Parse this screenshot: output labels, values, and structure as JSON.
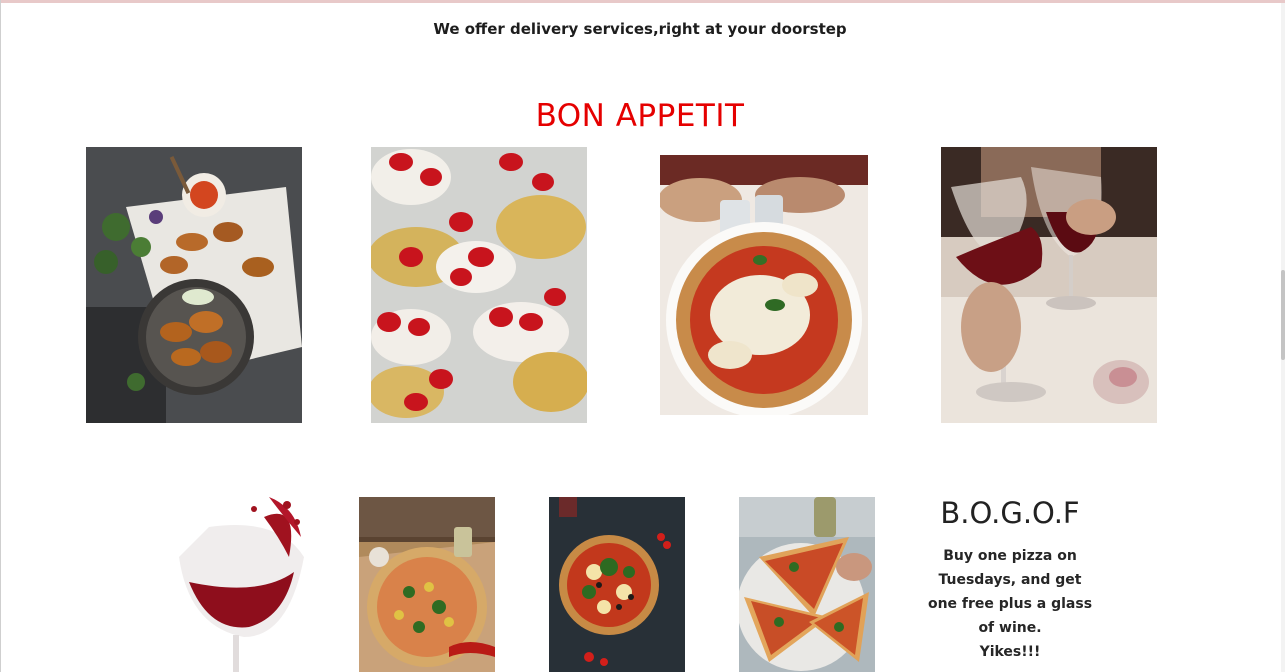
{
  "header": {
    "tagline": "We offer delivery services,right at your doorstep"
  },
  "gallery": {
    "title": "BON APPETIT",
    "title_color": "#e50000",
    "row1": [
      {
        "name": "chicken-wings-photo"
      },
      {
        "name": "strawberry-shortcake-photo"
      },
      {
        "name": "margherita-pizza-photo"
      },
      {
        "name": "red-wine-glasses-photo"
      }
    ],
    "row2": [
      {
        "name": "wine-splash-photo"
      },
      {
        "name": "pizza-on-board-photo"
      },
      {
        "name": "pizza-dark-table-photo"
      },
      {
        "name": "pizza-slices-photo"
      }
    ]
  },
  "promo": {
    "title": "B.O.G.O.F",
    "lines": [
      "Buy one pizza on",
      "Tuesdays, and get",
      "one free plus a glass",
      "of wine.",
      "Yikes!!!"
    ]
  }
}
